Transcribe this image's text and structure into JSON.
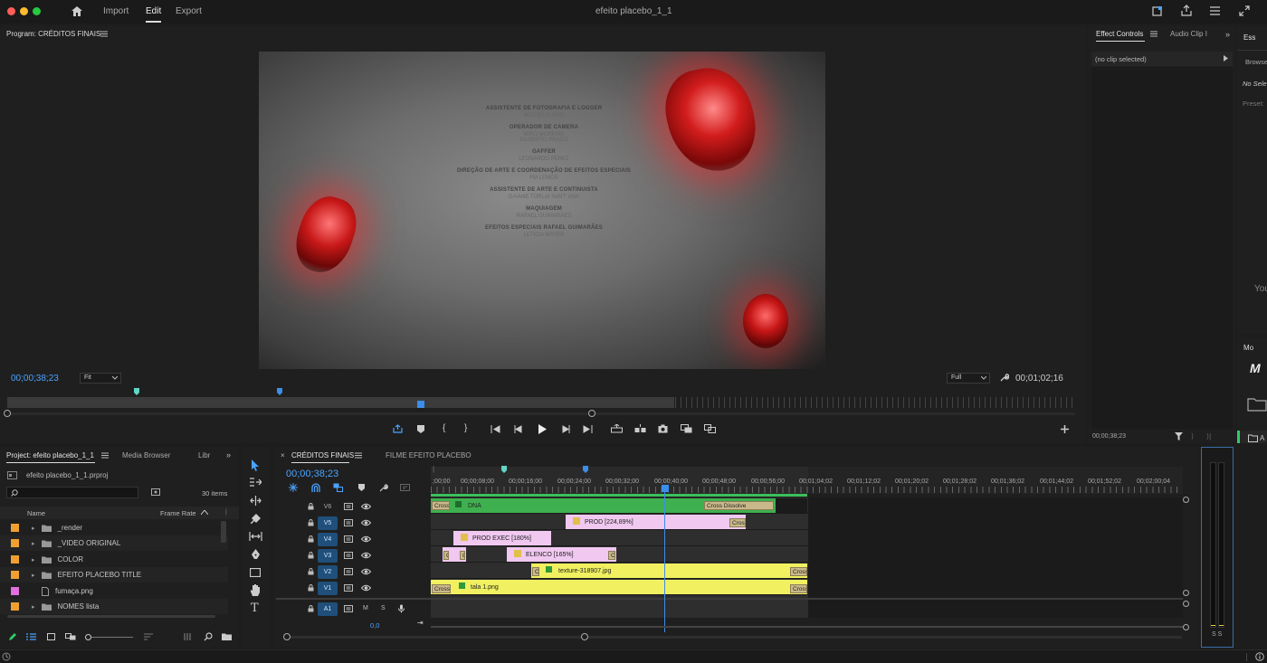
{
  "titlebar": {
    "nav_import": "Import",
    "nav_edit": "Edit",
    "nav_export": "Export",
    "project_title": "efeito placebo_1_1"
  },
  "program": {
    "title": "Program: CRÉDITOS FINAIS",
    "timecode_left": "00;00;38;23",
    "fit_select": "Fit",
    "quality_select": "Full",
    "timecode_right": "00;01;02;16",
    "credits": [
      {
        "role": "ASSISTENTE DE FOTOGRAFIA E LOGGER",
        "name": "MATHEUS ARID"
      },
      {
        "role": "OPERADOR DE CAMERA",
        "name": "MIRO MOREIRA\nGILBERTO PRADO"
      },
      {
        "role": "GAFFER",
        "name": "LEONARDO PEREZ"
      },
      {
        "role": "DIREÇÃO DE ARTE E COORDENAÇÃO DE EFEITOS ESPECIAIS",
        "name": "FM LEMOS"
      },
      {
        "role": "ASSISTENTE DE ARTE E CONTINUISTA",
        "name": "DAIANE TORLAI SANT' ANA"
      },
      {
        "role": "MAQUIAGEM",
        "name": "RAFAEL GUIMARÃES"
      },
      {
        "role": "EFEITOS ESPECIAIS RAFAEL GUIMARÃES",
        "name": "LETICIA MAYER"
      }
    ]
  },
  "effect_controls": {
    "tab1": "Effect Controls",
    "tab2": "Audio Clip I",
    "no_clip": "(no clip selected)",
    "timecode": "00;00;38;23"
  },
  "essentials": {
    "tab": "Ess",
    "browse": "Browse",
    "no_sel": "No Sele",
    "preset": "Preset:",
    "you": "You",
    "mo": "Mo"
  },
  "project": {
    "tab_project": "Project: efeito placebo_1_1",
    "tab_media": "Media Browser",
    "tab_lib": "Libr",
    "file": "efeito placebo_1_1.prproj",
    "items_count": "30 items",
    "col_name": "Name",
    "col_framerate": "Frame Rate",
    "items": [
      {
        "name": "_render",
        "color": "#f0a030",
        "type": "folder"
      },
      {
        "name": "_VIDEO ORIGINAL",
        "color": "#f0a030",
        "type": "folder"
      },
      {
        "name": "COLOR",
        "color": "#f0a030",
        "type": "folder"
      },
      {
        "name": "EFEITO PLACEBO TITLE",
        "color": "#f0a030",
        "type": "folder"
      },
      {
        "name": "fumaça.png",
        "color": "#e070e0",
        "type": "file"
      },
      {
        "name": "NOMES  lista",
        "color": "#f0a030",
        "type": "folder"
      }
    ]
  },
  "timeline": {
    "tab_active": "CRÉDITOS FINAIS",
    "tab_other": "FILME EFEITO PLACEBO",
    "timecode": "00;00;38;23",
    "audio_level": "0,0",
    "ruler": [
      ";00;00",
      "00;00;08;00",
      "00;00;16;00",
      "00;00;24;00",
      "00;00;32;00",
      "00;00;40;00",
      "00;00;48;00",
      "00;00;56;00",
      "00;01;04;02",
      "00;01;12;02",
      "00;01;20;02",
      "00;01;28;02",
      "00;01;36;02",
      "00;01;44;02",
      "00;01;52;02",
      "00;02;00;04"
    ],
    "tracks": [
      "V6",
      "V5",
      "V4",
      "V3",
      "V2",
      "V1",
      "A1"
    ],
    "clips": {
      "dna": "DNA",
      "cross_dissolve": "Cross Dissolve",
      "cross": "Cross",
      "prod": "PROD [224,89%]",
      "prod_exec": "PROD EXEC [180%]",
      "elenco": "ELENCO [165%]",
      "texture": "texture-318907.jpg",
      "tala": "tala 1.png",
      "c": "C",
      "m": "M",
      "s": "S"
    }
  },
  "meter": {
    "labels": "S S"
  }
}
